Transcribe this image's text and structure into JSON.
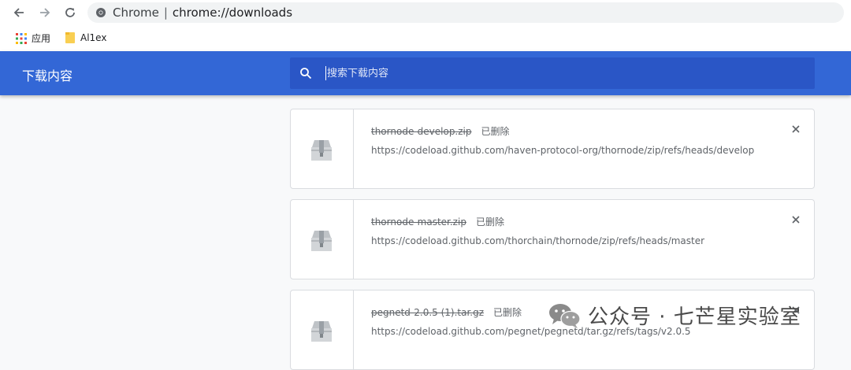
{
  "browser": {
    "omnibox": {
      "site_label": "Chrome",
      "url": "chrome://downloads"
    },
    "bookmarks": [
      {
        "label": "应用",
        "icon": "apps-grid-icon"
      },
      {
        "label": "Al1ex",
        "icon": "folder-icon"
      }
    ]
  },
  "toolbar": {
    "title": "下载内容",
    "search": {
      "placeholder": "搜索下载内容"
    }
  },
  "downloads": [
    {
      "file_name": "thornode-develop.zip",
      "status": "已删除",
      "url": "https://codeload.github.com/haven-protocol-org/thornode/zip/refs/heads/develop"
    },
    {
      "file_name": "thornode-master.zip",
      "status": "已删除",
      "url": "https://codeload.github.com/thorchain/thornode/zip/refs/heads/master"
    },
    {
      "file_name": "pegnetd-2.0.5 (1).tar.gz",
      "status": "已删除",
      "url": "https://codeload.github.com/pegnet/pegnetd/tar.gz/refs/tags/v2.0.5"
    }
  ],
  "watermark": {
    "text": "公众号 · 七芒星实验室"
  },
  "colors": {
    "toolbar": "#3367d6",
    "search_box": "#2a56c6",
    "page_background": "#f8f9fa"
  }
}
